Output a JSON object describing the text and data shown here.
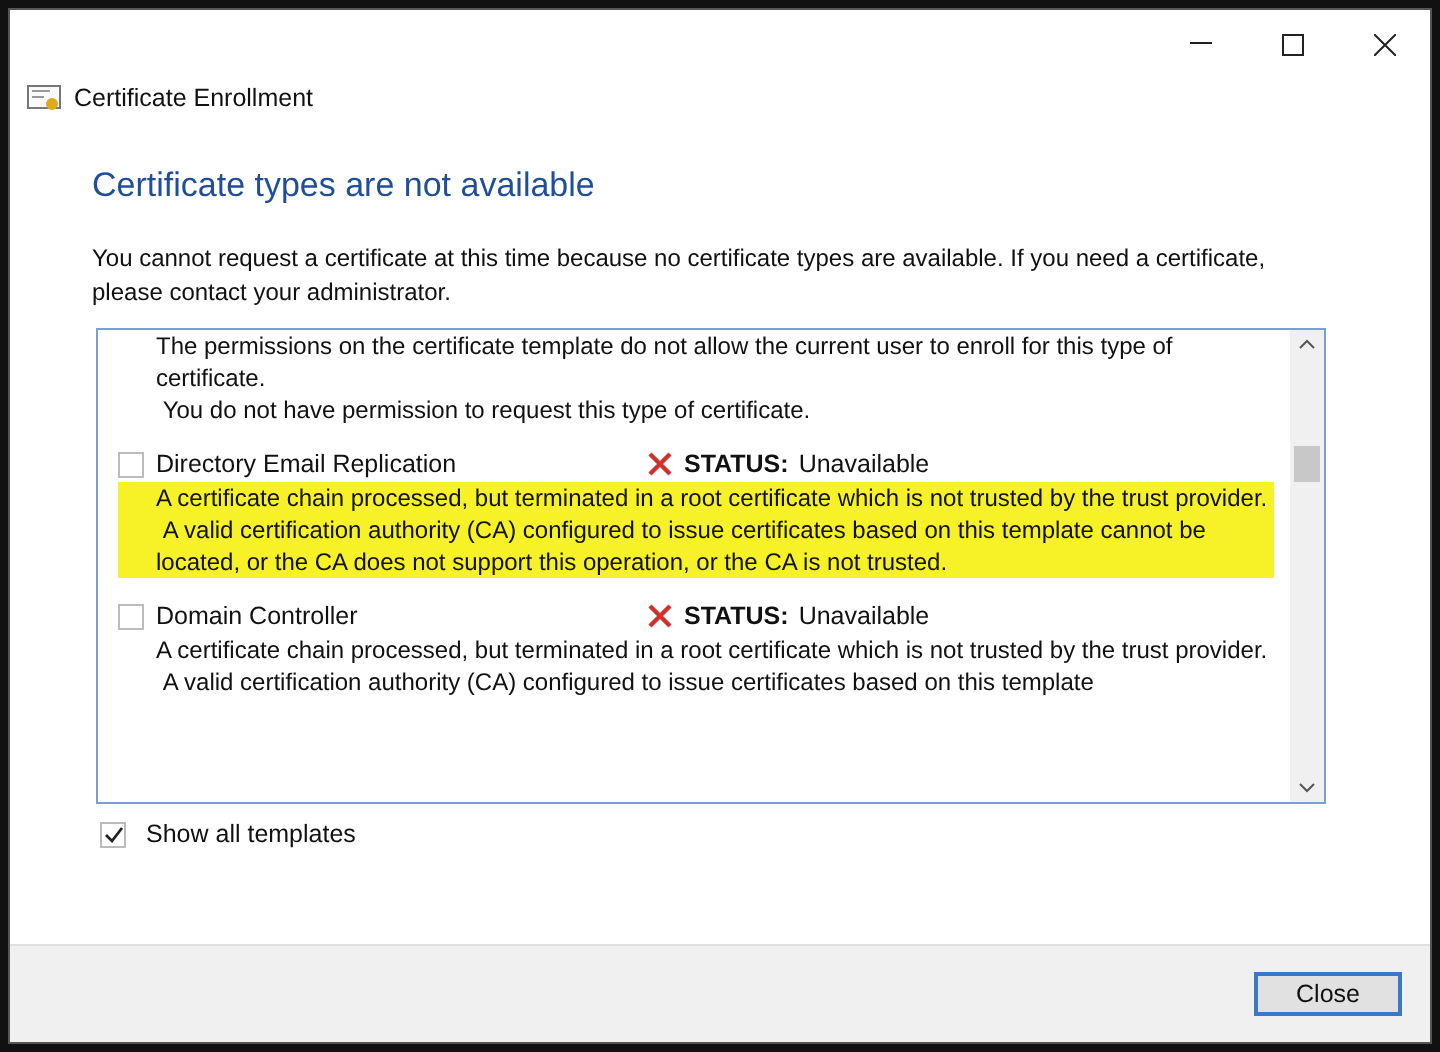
{
  "window": {
    "title": "Certificate Enrollment"
  },
  "heading": "Certificate types are not available",
  "message": "You cannot request a certificate at this time because no certificate types are available. If you need a certificate, please contact your administrator.",
  "templates": [
    {
      "kind": "continuation",
      "messages": [
        "The permissions on the certificate template do not allow the current user to enroll for this type of certificate.",
        " You do not have permission to request this type of certificate."
      ]
    },
    {
      "kind": "template",
      "name": "Directory Email Replication",
      "checked": false,
      "highlighted": true,
      "status_label": "STATUS:",
      "status": "Unavailable",
      "messages": [
        "A certificate chain processed, but terminated in a root certificate which is not trusted by the trust provider.",
        " A valid certification authority (CA) configured to issue certificates based on this template cannot be located, or the CA does not support this operation, or the CA is not trusted."
      ]
    },
    {
      "kind": "template",
      "name": "Domain Controller",
      "checked": false,
      "highlighted": false,
      "status_label": "STATUS:",
      "status": "Unavailable",
      "messages": [
        "A certificate chain processed, but terminated in a root certificate which is not trusted by the trust provider.",
        " A valid certification authority (CA) configured to issue certificates based on this template"
      ]
    }
  ],
  "show_all_templates": {
    "label": "Show all templates",
    "checked": true
  },
  "buttons": [
    "Close"
  ]
}
